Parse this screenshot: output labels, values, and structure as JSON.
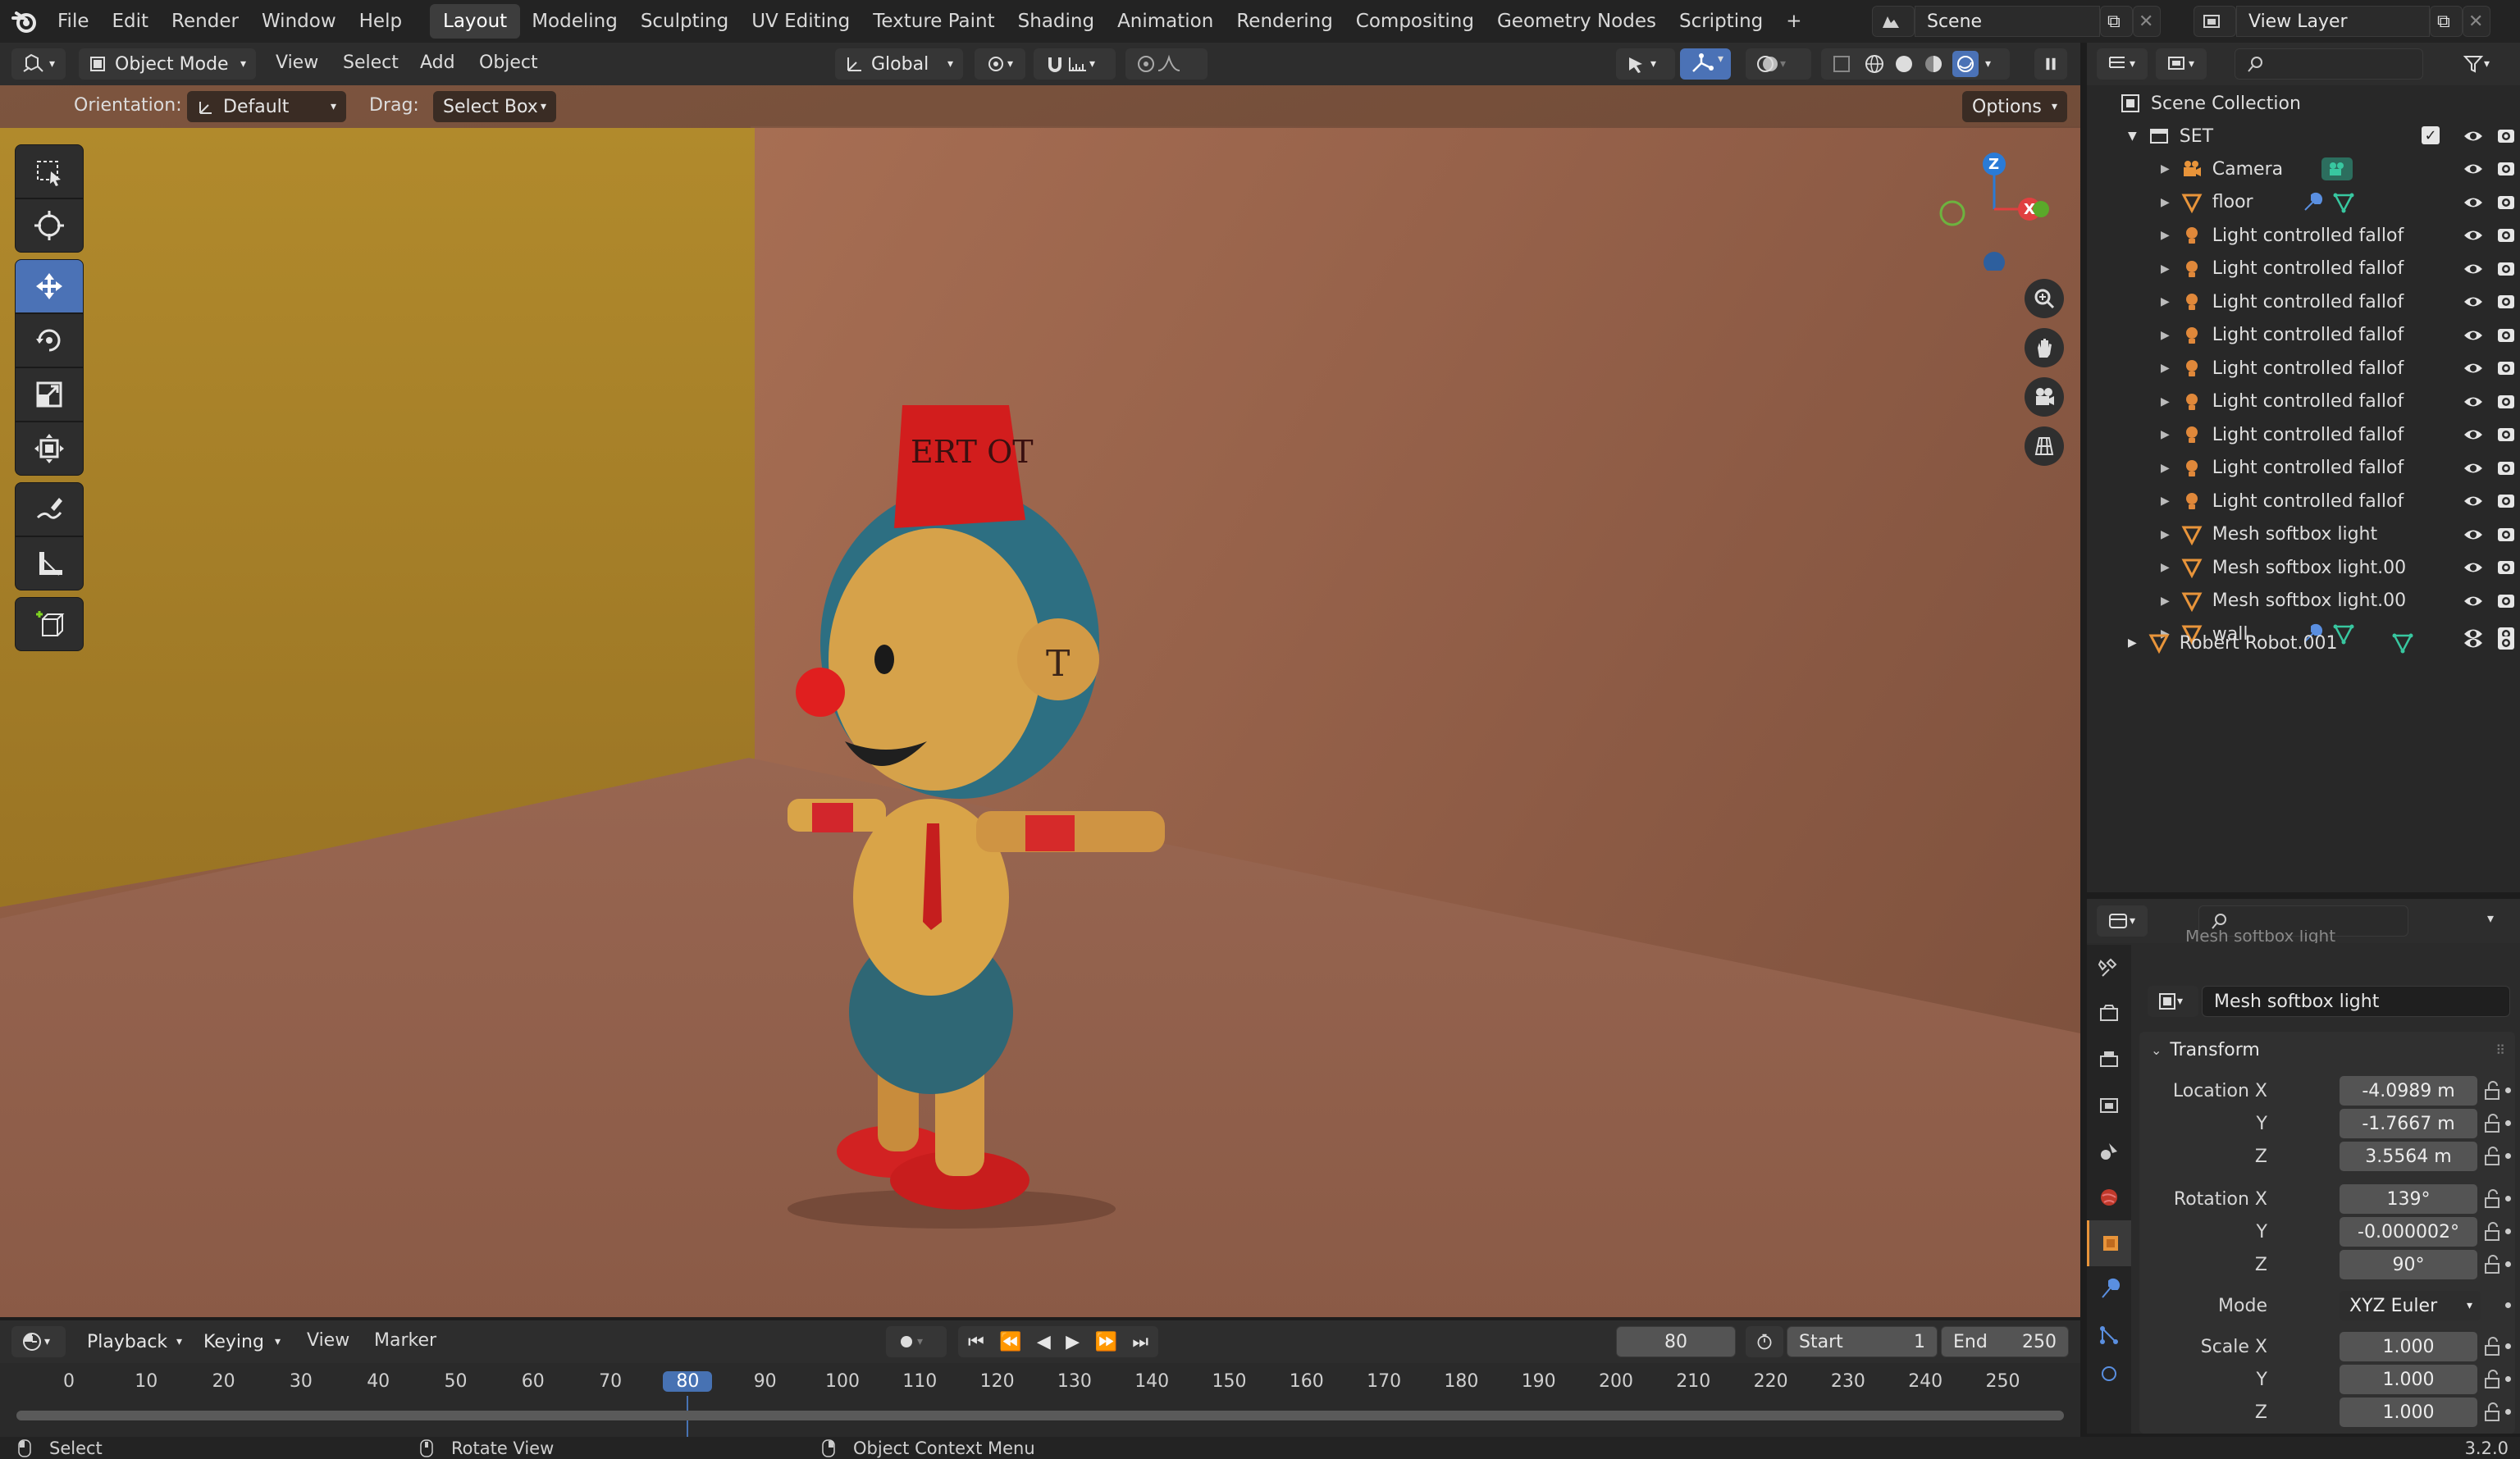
{
  "topbar": {
    "menu": [
      "File",
      "Edit",
      "Render",
      "Window",
      "Help"
    ],
    "workspaces": [
      "Layout",
      "Modeling",
      "Sculpting",
      "UV Editing",
      "Texture Paint",
      "Shading",
      "Animation",
      "Rendering",
      "Compositing",
      "Geometry Nodes",
      "Scripting"
    ],
    "active_workspace": "Layout",
    "add_workspace": "+",
    "scene": "Scene",
    "view_layer": "View Layer"
  },
  "viewport_header": {
    "mode": "Object Mode",
    "menus": [
      "View",
      "Select",
      "Add",
      "Object"
    ],
    "transform_orientation": "Global"
  },
  "tool_settings": {
    "orientation_label": "Orientation:",
    "orientation_value": "Default",
    "drag_label": "Drag:",
    "drag_value": "Select Box",
    "options_label": "Options"
  },
  "navigation_gizmo": {
    "z_label": "Z",
    "x_label": "X"
  },
  "robot": {
    "hat_text": "ERT OT"
  },
  "outliner": {
    "root": "Scene Collection",
    "collection": "SET",
    "items": [
      {
        "label": "Camera",
        "icon": "camera-icon"
      },
      {
        "label": "floor",
        "icon": "mesh-icon"
      },
      {
        "label": "Light controlled fallof",
        "icon": "light-icon"
      },
      {
        "label": "Light controlled fallof",
        "icon": "light-icon"
      },
      {
        "label": "Light controlled fallof",
        "icon": "light-icon"
      },
      {
        "label": "Light controlled fallof",
        "icon": "light-icon"
      },
      {
        "label": "Light controlled fallof",
        "icon": "light-icon"
      },
      {
        "label": "Light controlled fallof",
        "icon": "light-icon"
      },
      {
        "label": "Light controlled fallof",
        "icon": "light-icon"
      },
      {
        "label": "Light controlled fallof",
        "icon": "light-icon"
      },
      {
        "label": "Light controlled fallof",
        "icon": "light-icon"
      },
      {
        "label": "Mesh softbox light",
        "icon": "mesh-icon"
      },
      {
        "label": "Mesh softbox light.00",
        "icon": "mesh-icon"
      },
      {
        "label": "Mesh softbox light.00",
        "icon": "mesh-icon"
      },
      {
        "label": "wall",
        "icon": "mesh-icon"
      }
    ],
    "extra_root_item": "Robert Robot.001"
  },
  "properties": {
    "scrolled_header": "Mesh softbox light",
    "object_name": "Mesh softbox light",
    "panel": "Transform",
    "location_label": "Location X",
    "location": [
      "-4.0989 m",
      "-1.7667 m",
      "3.5564 m"
    ],
    "rotation_label": "Rotation X",
    "rotation": [
      "139°",
      "-0.000002°",
      "90°"
    ],
    "axis_labels": [
      "Y",
      "Z"
    ],
    "mode_label": "Mode",
    "mode_value": "XYZ Euler",
    "scale_label": "Scale X",
    "scale": [
      "1.000",
      "1.000",
      "1.000"
    ]
  },
  "timeline": {
    "menus": [
      "Playback",
      "Keying",
      "View",
      "Marker"
    ],
    "current_frame": "80",
    "start_label": "Start",
    "start": "1",
    "end_label": "End",
    "end": "250",
    "ticks": [
      "0",
      "10",
      "20",
      "30",
      "40",
      "50",
      "60",
      "70",
      "80",
      "90",
      "100",
      "110",
      "120",
      "130",
      "140",
      "150",
      "160",
      "170",
      "180",
      "190",
      "200",
      "210",
      "220",
      "230",
      "240",
      "250"
    ]
  },
  "statusbar": {
    "select": "Select",
    "rotate": "Rotate View",
    "context": "Object Context Menu",
    "version": "3.2.0"
  },
  "colors": {
    "accent": "#4b72b6",
    "current_frame": "#4772b3",
    "light_icon": "#e0883a",
    "mesh_icon": "#e8943a",
    "modifier_icon": "#5a8fe0",
    "data_icon": "#38c7a0"
  }
}
